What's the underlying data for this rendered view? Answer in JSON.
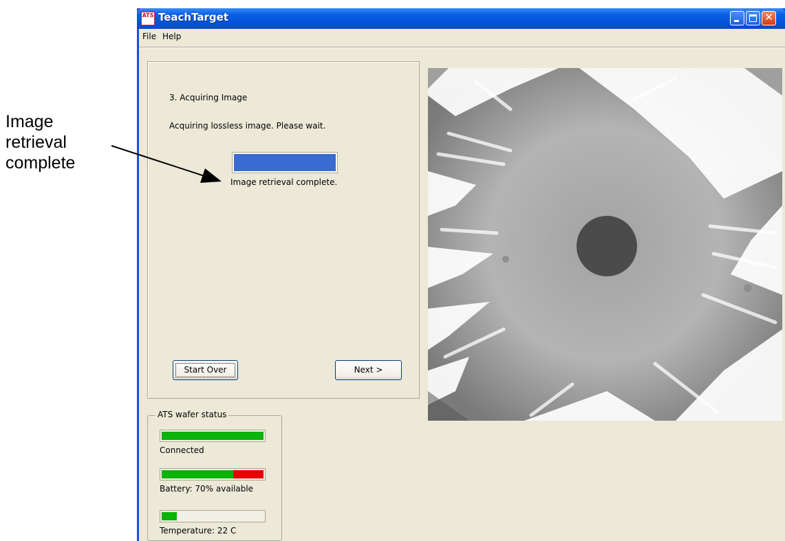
{
  "annotation": {
    "lines": [
      "Image",
      "retrieval",
      "complete"
    ]
  },
  "window": {
    "title": "TeachTarget",
    "icon_text": "ATS",
    "controls": {
      "minimize": "minimize-icon",
      "maximize": "maximize-icon",
      "close": "close-icon"
    }
  },
  "menu": {
    "file": "File",
    "help": "Help"
  },
  "wizard": {
    "step_title": "3. Acquiring Image",
    "message": "Acquiring lossless image.  Please wait.",
    "image_progress": 1.0,
    "status": "Image retrieval complete.",
    "start_over": "Start Over",
    "next": "Next >"
  },
  "wafer_status": {
    "legend": "ATS wafer status",
    "connection": {
      "label": "Connected",
      "level": 1.0
    },
    "battery": {
      "label": "Battery: 70% available",
      "level": 0.7
    },
    "temperature": {
      "label": "Temperature: 22 C",
      "level": 0.15
    }
  },
  "colors": {
    "titlebar_blue": "#0a5ee6",
    "progress_blue": "#3a6bd0",
    "meter_green": "#0bb30b",
    "meter_red": "#e80000",
    "window_face": "#ece9d8"
  }
}
